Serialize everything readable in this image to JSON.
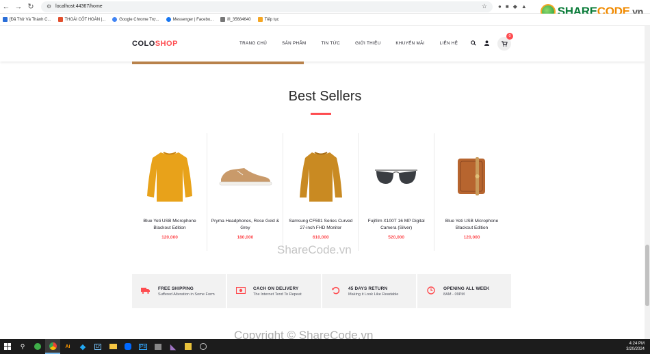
{
  "browser": {
    "url": "localhost:44367/home",
    "bookmarks": [
      "[Đã Thử Và Thành C...",
      "THOẢI CỐT HOÀN |...",
      "Google Chrome Trợ...",
      "Messenger | Facebo...",
      "ifl_35684640",
      "Tiếp tục"
    ]
  },
  "watermark": {
    "logo_share": "SHARE",
    "logo_code": "CODE",
    "logo_vn": ".vn",
    "mid_text": "ShareCode.vn",
    "bottom_text": "Copyright © ShareCode.vn"
  },
  "header": {
    "brand_left": "COLO",
    "brand_right": "SHOP",
    "menu": [
      "TRANG CHỦ",
      "SẢN PHẨM",
      "TIN TỨC",
      "GIỚI THIỆU",
      "KHUYẾN MÃI",
      "LIÊN HỆ"
    ],
    "cart_count": "0"
  },
  "section": {
    "title": "Best Sellers"
  },
  "products": [
    {
      "name": "Blue Yeti USB Microphone Blackout Edition",
      "price": "120,000"
    },
    {
      "name": "Pryma Headphones, Rose Gold & Grey",
      "price": "180,000"
    },
    {
      "name": "Samsung CF591 Series Curved 27-inch FHD Monitor",
      "price": "610,000"
    },
    {
      "name": "Fujifilm X100T 16 MP Digital Camera (Silver)",
      "price": "520,000"
    },
    {
      "name": "Blue Yeti USB Microphone Blackout Edition",
      "price": "120,000"
    }
  ],
  "features": [
    {
      "title": "FREE SHIPPING",
      "subtitle": "Suffered Alteration in Some Form",
      "icon": "truck-icon"
    },
    {
      "title": "CACH ON DELIVERY",
      "subtitle": "The Internet Tend To Repeat",
      "icon": "money-icon"
    },
    {
      "title": "45 DAYS RETURN",
      "subtitle": "Making it Look Like Readable",
      "icon": "undo-icon"
    },
    {
      "title": "OPENING ALL WEEK",
      "subtitle": "8AM - 09PM",
      "icon": "clock-icon"
    }
  ],
  "taskbar": {
    "time": "4:24 PM",
    "date": "3/20/2024"
  },
  "colors": {
    "accent": "#fe4c50",
    "text_dark": "#1e1e27"
  }
}
